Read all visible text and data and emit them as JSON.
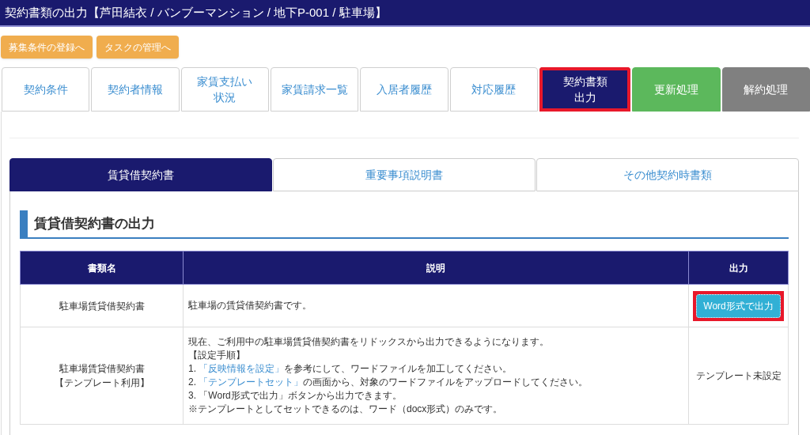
{
  "header": {
    "title": "契約書類の出力【芦田結衣 / バンブーマンション / 地下P-001 / 駐車場】"
  },
  "action_buttons": [
    "募集条件の登録へ",
    "タスクの管理へ"
  ],
  "tabs": [
    {
      "label": "契約条件",
      "kind": "normal",
      "selected": false,
      "highlighted": false
    },
    {
      "label": "契約者情報",
      "kind": "normal",
      "selected": false,
      "highlighted": false
    },
    {
      "label": [
        "家賃支払い",
        "状況"
      ],
      "kind": "normal",
      "selected": false,
      "highlighted": false
    },
    {
      "label": "家賃請求一覧",
      "kind": "normal",
      "selected": false,
      "highlighted": false
    },
    {
      "label": "入居者履歴",
      "kind": "normal",
      "selected": false,
      "highlighted": false
    },
    {
      "label": "対応履歴",
      "kind": "normal",
      "selected": false,
      "highlighted": false
    },
    {
      "label": [
        "契約書類",
        "出力"
      ],
      "kind": "normal",
      "selected": true,
      "highlighted": true
    },
    {
      "label": "更新処理",
      "kind": "renew",
      "selected": false,
      "highlighted": false
    },
    {
      "label": "解約処理",
      "kind": "cancel",
      "selected": false,
      "highlighted": false
    }
  ],
  "sub_tabs": [
    {
      "label": "賃貸借契約書",
      "selected": true
    },
    {
      "label": "重要事項説明書",
      "selected": false
    },
    {
      "label": "その他契約時書類",
      "selected": false
    }
  ],
  "section_title": "賃貸借契約書の出力",
  "table": {
    "columns": [
      "書類名",
      "説明",
      "出力"
    ],
    "rows": [
      {
        "name": [
          "駐車場賃貸借契約書"
        ],
        "description": [
          [
            {
              "kind": "text",
              "text": "駐車場の賃貸借契約書です。"
            }
          ]
        ],
        "output": {
          "kind": "button",
          "label": "Word形式で出力",
          "highlighted": true
        }
      },
      {
        "name": [
          "駐車場賃貸借契約書",
          "【テンプレート利用】"
        ],
        "description": [
          [
            {
              "kind": "text",
              "text": "現在、ご利用中の駐車場賃貸借契約書をリドックスから出力できるようになります。"
            }
          ],
          [
            {
              "kind": "text",
              "text": "【設定手順】"
            }
          ],
          [
            {
              "kind": "text",
              "text": "1. "
            },
            {
              "kind": "link",
              "text": "「反映情報を設定」"
            },
            {
              "kind": "text",
              "text": "を参考にして、ワードファイルを加工してください。"
            }
          ],
          [
            {
              "kind": "text",
              "text": "2. "
            },
            {
              "kind": "link",
              "text": "「テンプレートセット」"
            },
            {
              "kind": "text",
              "text": "の画面から、対象のワードファイルをアップロードしてください。"
            }
          ],
          [
            {
              "kind": "text",
              "text": "3. 「Word形式で出力」ボタンから出力できます。"
            }
          ],
          [
            {
              "kind": "text",
              "text": "※テンプレートとしてセットできるのは、ワード（docx形式）のみです。"
            }
          ]
        ],
        "output": {
          "kind": "text",
          "label": "テンプレート未設定"
        }
      }
    ]
  }
}
